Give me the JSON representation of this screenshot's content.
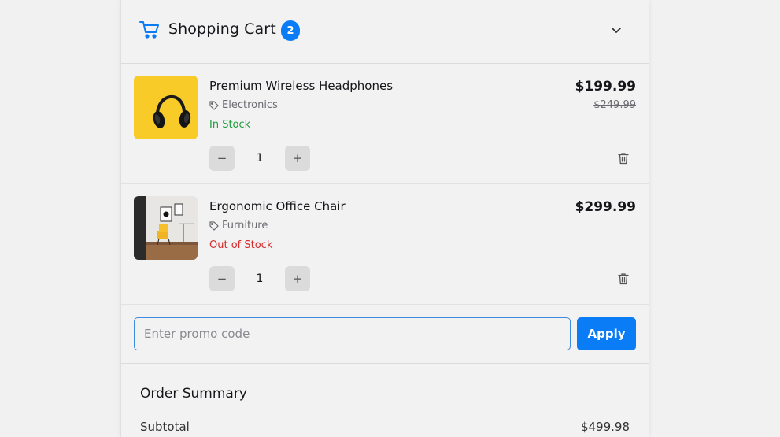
{
  "header": {
    "title": "Shopping Cart",
    "count": "2",
    "icon": "cart-icon",
    "accent": "#0a7cf5"
  },
  "items": [
    {
      "name": "Premium Wireless Headphones",
      "category": "Electronics",
      "stock": "In Stock",
      "price": "$199.99",
      "old_price": "$249.99",
      "quantity": "1",
      "minus": "−",
      "plus": "+"
    },
    {
      "name": "Ergonomic Office Chair",
      "category": "Furniture",
      "stock": "Out of Stock",
      "price": "$299.99",
      "quantity": "1",
      "minus": "−",
      "plus": "+"
    }
  ],
  "promo": {
    "placeholder": "Enter promo code",
    "value": "",
    "apply_label": "Apply"
  },
  "summary": {
    "title": "Order Summary",
    "subtotal_label": "Subtotal",
    "subtotal_value": "$499.98"
  },
  "colors": {
    "in_stock": "#1e9e3a",
    "out_of_stock": "#d42a2a"
  }
}
